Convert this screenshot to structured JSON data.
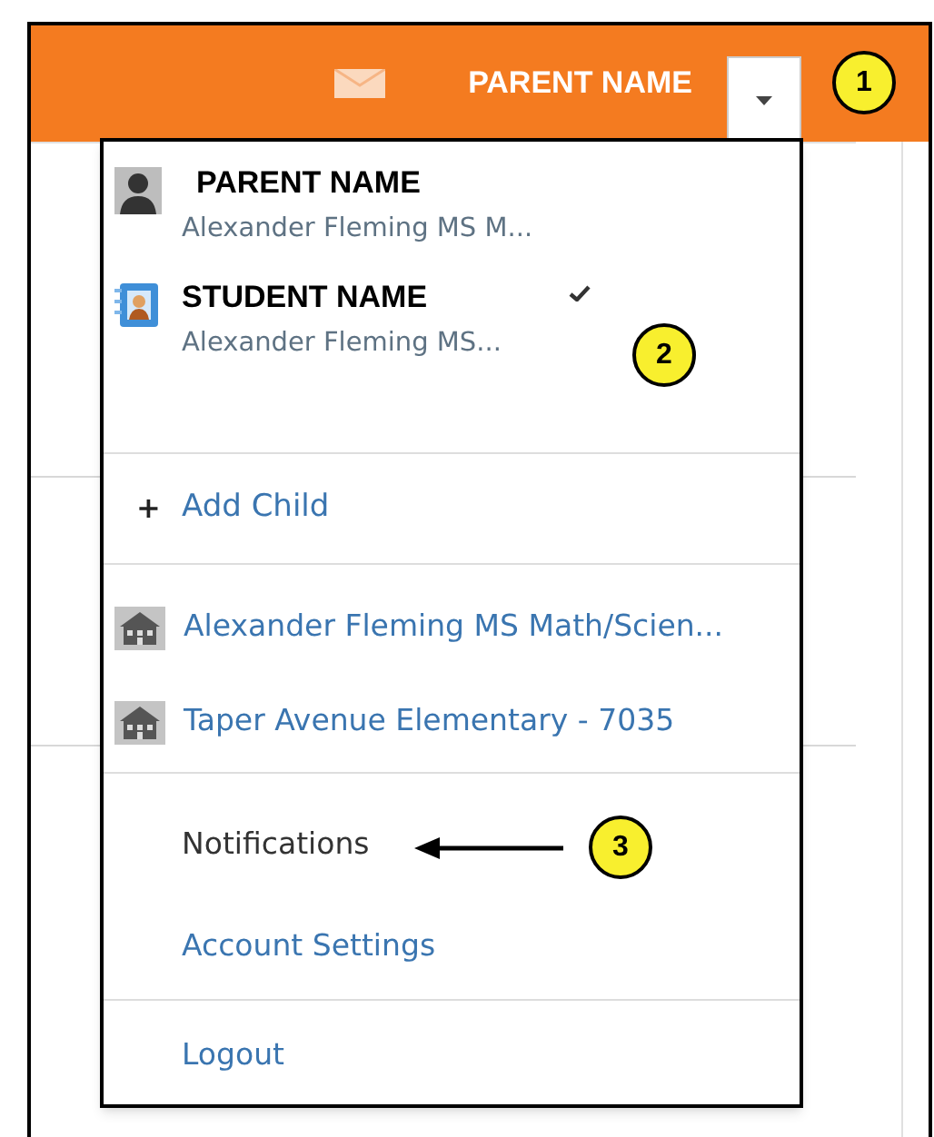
{
  "header": {
    "user_name": "PARENT NAME",
    "menu_open": true
  },
  "menu": {
    "accounts": [
      {
        "kind": "parent",
        "name": "PARENT NAME",
        "school": "Alexander Fleming MS M...",
        "selected": false
      },
      {
        "kind": "student",
        "name": "STUDENT NAME",
        "school": "Alexander Fleming MS...",
        "selected": true
      }
    ],
    "add_child": {
      "symbol": "+",
      "label": "Add Child"
    },
    "schools": [
      {
        "label": "Alexander Fleming MS Math/Scien..."
      },
      {
        "label": "Taper Avenue Elementary - 7035"
      }
    ],
    "links": [
      {
        "kind": "plain",
        "label": "Notifications"
      },
      {
        "kind": "link",
        "label": "Account Settings"
      }
    ],
    "logout": "Logout"
  },
  "callouts": [
    "1",
    "2",
    "3"
  ]
}
